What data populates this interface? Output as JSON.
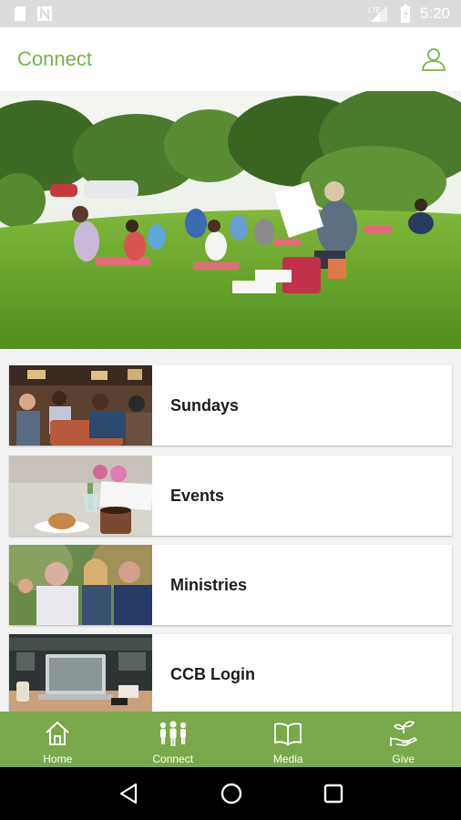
{
  "status_bar": {
    "time": "5:20",
    "network_label": "LTE"
  },
  "app_bar": {
    "title": "Connect",
    "profile_icon": "person-outline-icon"
  },
  "hero": {
    "image": "outdoor-group-on-lawn-photo"
  },
  "menu": {
    "items": [
      {
        "label": "Sundays",
        "thumb": "congregation-photo"
      },
      {
        "label": "Events",
        "thumb": "coffee-and-flowers-photo"
      },
      {
        "label": "Ministries",
        "thumb": "people-talking-photo"
      },
      {
        "label": "CCB Login",
        "thumb": "laptop-desk-photo"
      }
    ]
  },
  "tab_bar": {
    "tabs": [
      {
        "label": "Home",
        "icon": "home-icon"
      },
      {
        "label": "Connect",
        "icon": "people-icon"
      },
      {
        "label": "Media",
        "icon": "book-icon"
      },
      {
        "label": "Give",
        "icon": "hand-plant-icon"
      }
    ]
  },
  "colors": {
    "brand_green": "#7aa84a",
    "title_green": "#7ab24a"
  }
}
